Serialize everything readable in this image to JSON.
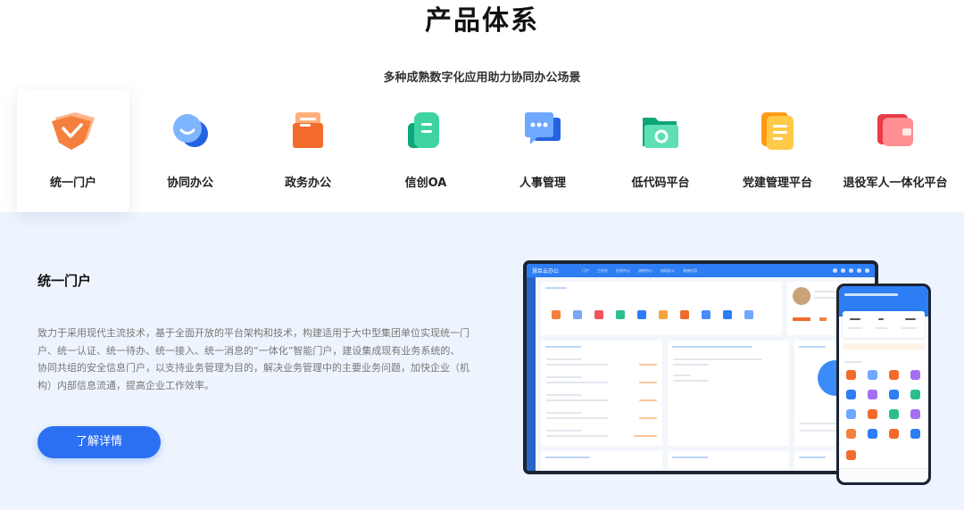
{
  "section": {
    "title": "产品体系",
    "subtitle": "多种成熟数字化应用助力协同办公场景"
  },
  "tabs": [
    {
      "label": "统一门户",
      "icon": "shield-check-icon",
      "active": true
    },
    {
      "label": "协同办公",
      "icon": "chat-smile-icon",
      "active": false
    },
    {
      "label": "政务办公",
      "icon": "envelope-icon",
      "active": false
    },
    {
      "label": "信创OA",
      "icon": "document-stack-icon",
      "active": false
    },
    {
      "label": "人事管理",
      "icon": "chat-bubble-icon",
      "active": false
    },
    {
      "label": "低代码平台",
      "icon": "folder-gear-icon",
      "active": false
    },
    {
      "label": "党建管理平台",
      "icon": "clipboard-list-icon",
      "active": false
    },
    {
      "label": "退役军人一体化平台",
      "icon": "wallet-icon",
      "active": false
    }
  ],
  "detail": {
    "title": "统一门户",
    "description": "致力于采用现代主流技术，基于全面开放的平台架构和技术，构建适用于大中型集团单位实现统一门户、统一认证、统一待办、统一接入、统一消息的“一体化”智能门户，建设集成现有业务系统的、协同共组的安全信息门户，以支持业务管理为目的，解决业务管理中的主要业务问题，加快企业（机构）内部信息流通，提高企业工作效率。",
    "cta_label": "了解详情"
  },
  "mockup": {
    "brand": "慧臣云办公",
    "nav": [
      "门户",
      "工作台",
      "信息中心",
      "流程中心",
      "协同办公",
      "系统应用"
    ]
  },
  "colors": {
    "primary": "#2b6ff3",
    "panel_bg": "#eef4fd",
    "accent_orange": "#f5803e",
    "accent_green": "#1fbf8f"
  }
}
